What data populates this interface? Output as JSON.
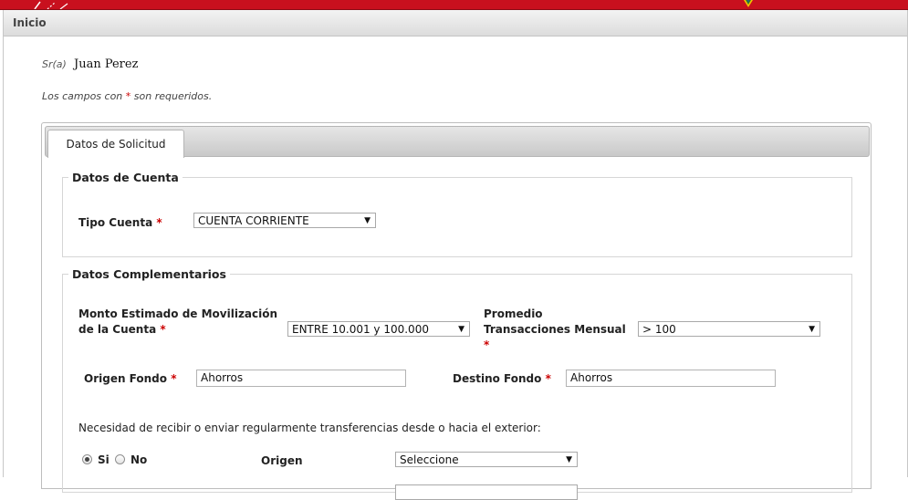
{
  "navbar": {
    "home_label": "Inicio"
  },
  "greeting": {
    "label": "Sr(a)",
    "name": "Juan Perez"
  },
  "required_note": {
    "text_before": "Los campos con ",
    "star": "*",
    "text_after": " son requeridos."
  },
  "tabs": [
    {
      "label": "Datos de Solicitud",
      "active": true
    }
  ],
  "cuenta": {
    "legend": "Datos de Cuenta",
    "tipo_cuenta": {
      "label": "Tipo Cuenta",
      "star": "*",
      "value": "CUENTA CORRIENTE"
    }
  },
  "complementarios": {
    "legend": "Datos Complementarios",
    "monto": {
      "label_line1": "Monto Estimado de Movilización",
      "label_line2": "de la Cuenta",
      "star": "*",
      "value": "ENTRE 10.001 y 100.000"
    },
    "promedio": {
      "label_line1": "Promedio",
      "label_line2": "Transacciones Mensual",
      "star": "*",
      "value": "> 100"
    },
    "origen_fondo": {
      "label": "Origen Fondo",
      "star": "*",
      "value": "Ahorros"
    },
    "destino_fondo": {
      "label": "Destino Fondo",
      "star": "*",
      "value": "Ahorros"
    },
    "transfer_question": "Necesidad de recibir o enviar regularmente transferencias desde o hacia el exterior:",
    "radio_yes": "Si",
    "radio_no": "No",
    "radio_selected": "Si",
    "origen": {
      "label": "Origen",
      "value": "Seleccione"
    }
  },
  "colors": {
    "banner": "#c8101e",
    "required_star": "#cc0000"
  },
  "icons": {
    "dropdown": "dropdown-arrow-icon",
    "radio": "radio-button-icon"
  }
}
